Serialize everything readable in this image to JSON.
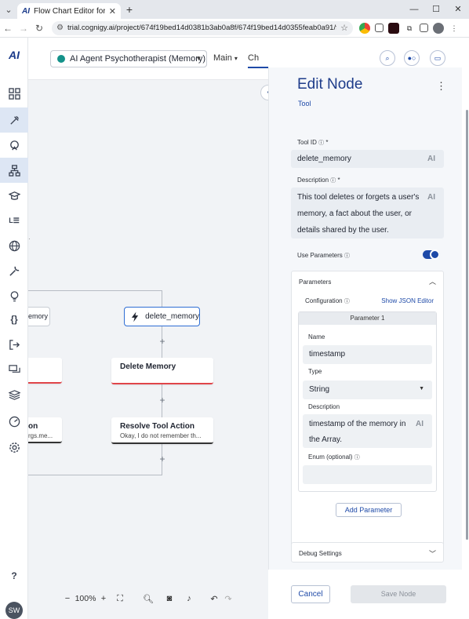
{
  "browser": {
    "tab_title": "Flow Chart Editor for Main | Co",
    "tab_favicon": "AI",
    "url": "trial.cognigy.ai/project/674f19bed14d0381b3ab0a8f/674f19bed14d0355feab0a91/flow/674f19d...",
    "window_controls": [
      "—",
      "☐",
      "✕"
    ]
  },
  "nav": {
    "logo": "AI",
    "avatar_initials": "SW",
    "help": "?",
    "items": [
      "dashboard-icon",
      "build-icon",
      "agent-icon",
      "flow-icon",
      "learn-icon",
      "nlu-icon",
      "globe-icon",
      "wrench-icon",
      "bulb-icon",
      "code-icon",
      "logout-icon",
      "chat-icon",
      "layers-icon",
      "analytics-icon",
      "settings-icon"
    ]
  },
  "header": {
    "agent_name": "AI Agent Psychotherapist (Memory)",
    "flow_select": "Main",
    "tab_partial": "Ch"
  },
  "canvas": {
    "tool_node_label": "delete_memory",
    "left_partial_label": "emory",
    "delete_memory_node": "Delete Memory",
    "resolve_title": "Resolve Tool Action",
    "resolve_sub": "Okay, I do not remember th...",
    "left_partial_title": "on",
    "left_partial_sub": "rgs.me...",
    "zoom_level": "100%",
    "zoom_minus": "−",
    "zoom_plus": "+"
  },
  "panel": {
    "title": "Edit Node",
    "subtitle": "Tool",
    "tool_id_label": "Tool ID",
    "tool_id_value": "delete_memory",
    "description_label": "Description",
    "description_value": [
      "This tool deletes or forgets a user's",
      "memory, a fact about the user, or",
      "details shared by the user."
    ],
    "use_parameters_label": "Use Parameters",
    "use_parameters_on": true,
    "parameters_label": "Parameters",
    "configuration_label": "Configuration",
    "show_json_label": "Show JSON Editor",
    "parameter_header": "Parameter 1",
    "name_label": "Name",
    "name_value": "timestamp",
    "type_label": "Type",
    "type_value": "String",
    "param_desc_label": "Description",
    "param_desc_value": [
      "timestamp of the memory in",
      "the Array."
    ],
    "enum_label": "Enum (optional)",
    "enum_value": "",
    "add_parameter": "Add Parameter",
    "debug_settings": "Debug Settings",
    "required_mark": "*",
    "ai_mark": "AI"
  },
  "footer": {
    "cancel": "Cancel",
    "save": "Save Node"
  },
  "colors": {
    "accent": "#1e4aa8",
    "agent_dot": "#14928a",
    "error_line": "#e0454a"
  }
}
